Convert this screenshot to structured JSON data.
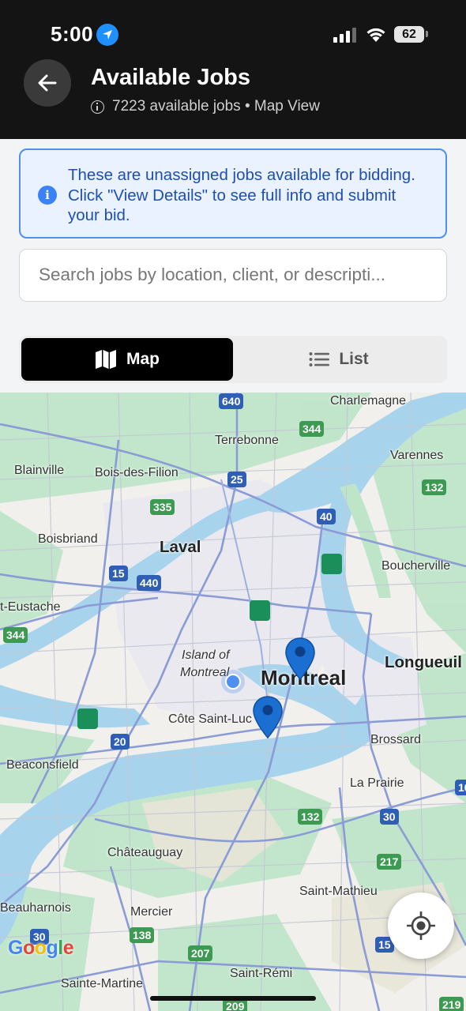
{
  "status_bar": {
    "time": "5:00",
    "battery": "62",
    "icons": [
      "location-arrow-icon",
      "cellular-signal-icon",
      "wifi-icon",
      "battery-icon"
    ]
  },
  "header": {
    "title": "Available Jobs",
    "subtitle": "7223 available jobs • Map View",
    "back_icon": "arrow-left-icon",
    "subtitle_icon": "info-circle-icon"
  },
  "banner": {
    "text": "These are unassigned jobs available for bidding. Click \"View Details\" to see full info and submit your bid.",
    "icon": "info-icon",
    "color": "#1f4fb0",
    "background": "#eaf2ff",
    "border": "#4f8ff0"
  },
  "search": {
    "placeholder": "Search jobs by location, client, or descripti...",
    "value": ""
  },
  "view_toggle": {
    "map_label": "Map",
    "list_label": "List",
    "active": "Map",
    "map_icon": "map-icon",
    "list_icon": "list-icon"
  },
  "map": {
    "places": {
      "charlemagne": "Charlemagne",
      "terrebonne": "Terrebonne",
      "varennes": "Varennes",
      "blainville": "Blainville",
      "bois_des_filion": "Bois-des-Filion",
      "boisbriand": "Boisbriand",
      "laval": "Laval",
      "boucherville": "Boucherville",
      "st_eustache": "t-Eustache",
      "island_of_montreal_1": "Island of",
      "island_of_montreal_2": "Montreal",
      "montreal": "Montreal",
      "longueuil": "Longueuil",
      "cote_saint_luc": "Côte Saint-Luc",
      "brossard": "Brossard",
      "beaconsfield": "Beaconsfield",
      "la_prairie": "La Prairie",
      "chateauguay": "Châteauguay",
      "saint_mathieu": "Saint-Mathieu",
      "beauharnois": "Beauharnois",
      "mercier": "Mercier",
      "saint_remi": "Saint-Rémi",
      "sainte_martine": "Sainte-Martine"
    },
    "highway_shields": {
      "h640": "640",
      "h344a": "344",
      "h25": "25",
      "h132a": "132",
      "h335": "335",
      "h40": "40",
      "h15a": "15",
      "h440": "440",
      "h344b": "344",
      "h20": "20",
      "h132b": "132",
      "h30a": "30",
      "h217": "217",
      "h138": "138",
      "h207": "207",
      "h30b": "30",
      "h15b": "15",
      "h209": "209",
      "h219": "219",
      "h10": "10"
    },
    "job_pin_count": 2,
    "colors": {
      "water": "#9fd0ea",
      "park": "#b9e3c6",
      "pin": "#1a6fd0",
      "highway": "#8a9bd6"
    },
    "google_logo": "Google",
    "locate_icon": "crosshair-icon"
  }
}
